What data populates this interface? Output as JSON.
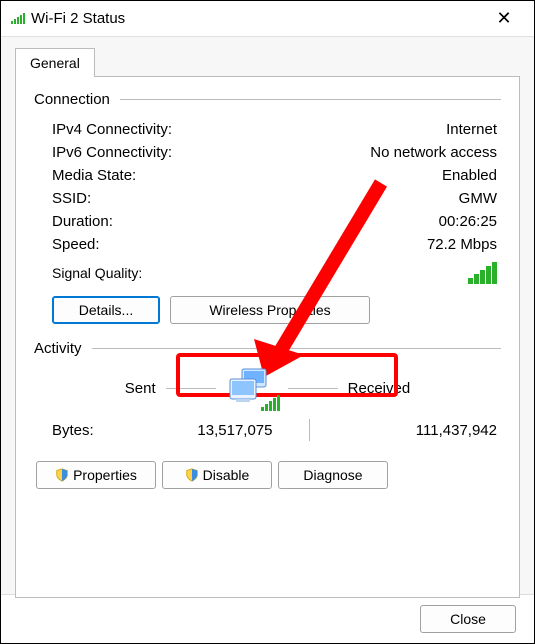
{
  "window": {
    "title": "Wi-Fi 2 Status"
  },
  "tabs": {
    "general": "General"
  },
  "connection": {
    "header": "Connection",
    "ipv4_label": "IPv4 Connectivity:",
    "ipv4_value": "Internet",
    "ipv6_label": "IPv6 Connectivity:",
    "ipv6_value": "No network access",
    "media_label": "Media State:",
    "media_value": "Enabled",
    "ssid_label": "SSID:",
    "ssid_value": "GMW",
    "duration_label": "Duration:",
    "duration_value": "00:26:25",
    "speed_label": "Speed:",
    "speed_value": "72.2 Mbps",
    "signal_label": "Signal Quality:",
    "details_btn": "Details...",
    "wprops_btn": "Wireless Properties"
  },
  "activity": {
    "header": "Activity",
    "sent_label": "Sent",
    "received_label": "Received",
    "bytes_label": "Bytes:",
    "bytes_sent": "13,517,075",
    "bytes_received": "111,437,942",
    "properties_btn": "Properties",
    "disable_btn": "Disable",
    "diagnose_btn": "Diagnose"
  },
  "footer": {
    "close_btn": "Close"
  },
  "annotation": {
    "highlight_target": "wireless-properties-button"
  }
}
